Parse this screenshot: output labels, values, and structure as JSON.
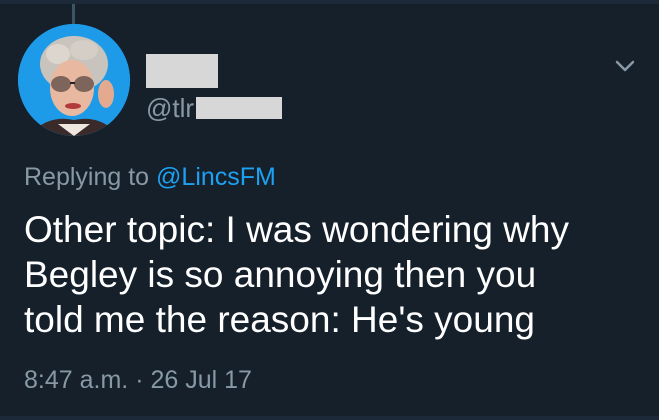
{
  "tweet": {
    "handle_prefix": "@tlr",
    "reply_prefix": "Replying to",
    "reply_mention": "@LincsFM",
    "text_lines": [
      "Other topic: I was wondering why",
      "Begley is so annoying then you",
      "told me the reason: He's young"
    ],
    "time": "8:47 a.m.",
    "separator": "·",
    "date": "26 Jul 17"
  },
  "icons": {
    "menu": "chevron-down-icon",
    "avatar": "avatar"
  },
  "colors": {
    "background": "#15202b",
    "text": "#ffffff",
    "secondary": "#8899a6",
    "accent": "#1da1f2",
    "redaction": "#d7d7d7"
  }
}
